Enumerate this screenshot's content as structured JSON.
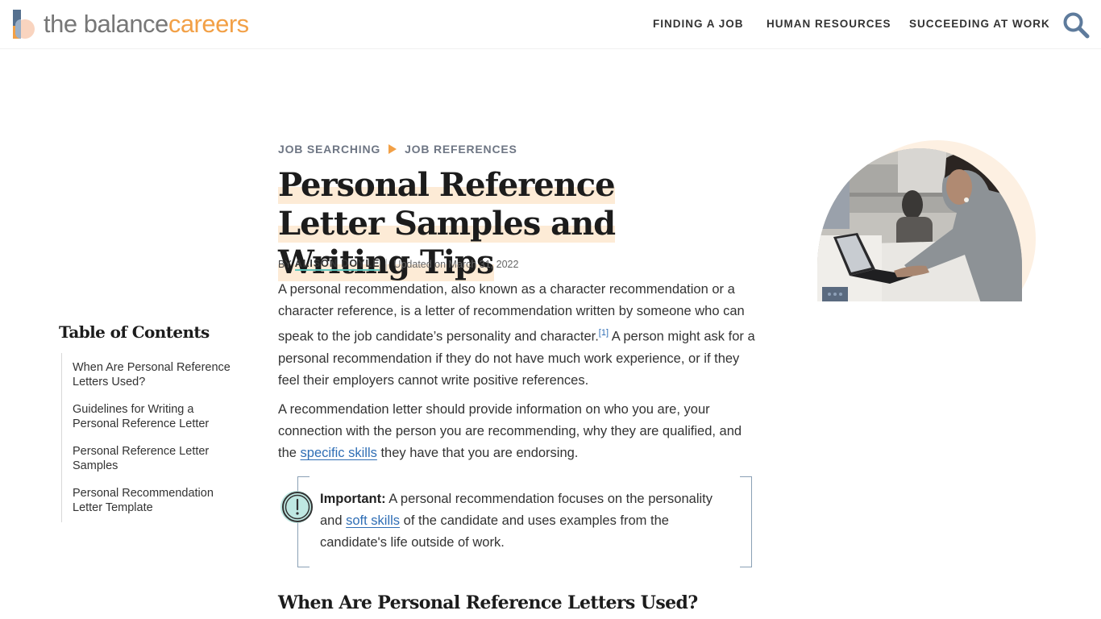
{
  "header": {
    "logo": {
      "part1": "the balance",
      "part2": "careers"
    },
    "nav": [
      {
        "label": "FINDING A JOB"
      },
      {
        "label": "HUMAN RESOURCES"
      },
      {
        "label": "SUCCEEDING AT WORK"
      }
    ],
    "search_icon": "search-icon"
  },
  "breadcrumb": {
    "items": [
      {
        "label": "JOB SEARCHING"
      },
      {
        "label": "JOB REFERENCES"
      }
    ],
    "separator_icon": "triangle-right-icon"
  },
  "article": {
    "title": "Personal Reference Letter Samples and Writing Tips",
    "byline": {
      "prefix": "BY",
      "author": "ALISON DOYLE",
      "updated": "Updated on March 31, 2022"
    },
    "paragraph1": {
      "text_before_ref": "A personal recommendation, also known as a character recommendation or a character reference, is a letter of recommendation written by someone who can speak to the job candidate’s personality and character.",
      "ref": "[1]",
      "text_after_ref": " A person might ask for a personal recommendation if they do not have much work experience, or if they feel their employers cannot write positive references."
    },
    "paragraph2": {
      "text_before_link": "A recommendation letter should provide information on who you are, your connection with the person you are recommending, why they are qualified, and the ",
      "link": "specific skills",
      "text_after_link": " they have that you are endorsing."
    },
    "callout": {
      "icon": "exclamation-circle-icon",
      "label": "Important:",
      "text_before_link": " A personal recommendation focuses on the personality and ",
      "link": "soft skills",
      "text_after_link": " of the candidate and uses examples from the candidate's life outside of work."
    },
    "section_heading": "When Are Personal Reference Letters Used?"
  },
  "toc": {
    "title": "Table of Contents",
    "items": [
      {
        "label": "When Are Personal Reference Letters Used?"
      },
      {
        "label": "Guidelines for Writing a Personal Reference Letter"
      },
      {
        "label": "Personal Reference Letter Samples"
      },
      {
        "label": "Personal Recommendation Letter Template"
      }
    ]
  },
  "hero": {
    "image": "woman-typing-on-laptop-photo",
    "more_button_icon": "more-dots-icon"
  },
  "colors": {
    "accent_orange": "#f2a046",
    "link_blue": "#2f6eb5",
    "title_highlight": "#fdebd6",
    "author_underline": "#5ec6bc",
    "logo_blue": "#55708f"
  }
}
